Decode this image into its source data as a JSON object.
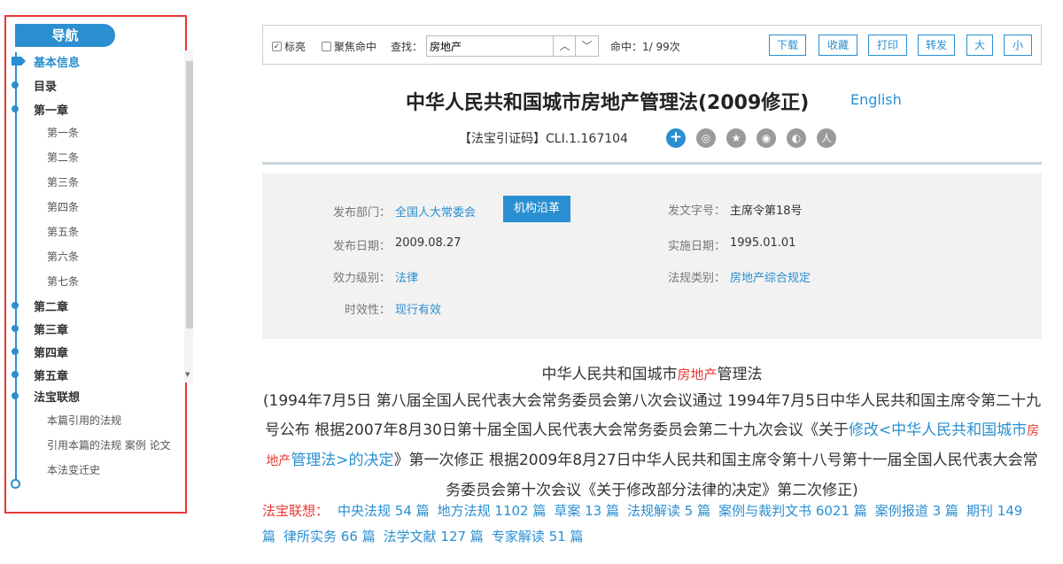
{
  "nav": {
    "title": "导航",
    "items": [
      {
        "label": "基本信息",
        "level": 1,
        "active": true
      },
      {
        "label": "目录",
        "level": 1
      },
      {
        "label": "第一章",
        "level": 1
      },
      {
        "label": "第一条",
        "level": 2
      },
      {
        "label": "第二条",
        "level": 2
      },
      {
        "label": "第三条",
        "level": 2
      },
      {
        "label": "第四条",
        "level": 2
      },
      {
        "label": "第五条",
        "level": 2
      },
      {
        "label": "第六条",
        "level": 2
      },
      {
        "label": "第七条",
        "level": 2
      },
      {
        "label": "第二章",
        "level": 1
      },
      {
        "label": "第三章",
        "level": 1
      },
      {
        "label": "第四章",
        "level": 1
      },
      {
        "label": "第五章",
        "level": 1
      },
      {
        "label": "法宝联想",
        "level": 1
      },
      {
        "label": "本篇引用的法规",
        "level": 2
      },
      {
        "label": "引用本篇的法规 案例 论文",
        "level": 2
      },
      {
        "label": "本法变迁史",
        "level": 2
      }
    ]
  },
  "toolbar": {
    "highlight_label": "标亮",
    "highlight_checked": true,
    "focus_label": "聚焦命中",
    "focus_checked": false,
    "search_label": "查找：",
    "search_value": "房地产",
    "hits": "命中：1/ 99次",
    "buttons": [
      "下载",
      "收藏",
      "打印",
      "转发",
      "大",
      "小"
    ]
  },
  "document": {
    "title": "中华人民共和国城市房地产管理法(2009修正)",
    "english_link": "English",
    "cite_label": "【法宝引证码】",
    "cite_code": "CLI.1.167104",
    "share_icons": [
      "plus-icon",
      "wechat-icon",
      "star-icon",
      "weibo-icon",
      "qq-icon",
      "renren-icon"
    ]
  },
  "meta": {
    "dept_label": "发布部门：",
    "dept_value": "全国人大常委会",
    "org_button": "机构沿革",
    "docno_label": "发文字号：",
    "docno_value": "主席令第18号",
    "pubdate_label": "发布日期：",
    "pubdate_value": "2009.08.27",
    "effdate_label": "实施日期：",
    "effdate_value": "1995.01.01",
    "level_label": "效力级别：",
    "level_value": "法律",
    "category_label": "法规类别：",
    "category_value": "房地产综合规定",
    "validity_label": "时效性：",
    "validity_value": "现行有效"
  },
  "body": {
    "title_pre": "中华人民共和国城市",
    "title_hl": "房地产",
    "title_post": "管理法",
    "preamble_1": "(1994年7月5日 第八届全国人民代表大会常务委员会第八次会议通过 1994年7月5日中华人民共和国主席令第二十九号公布 根据2007年8月30日第十届全国人民代表大会常务委员会第二十九次会议《关于",
    "preamble_link_1": "修改<中华人民共和国城市",
    "preamble_link_hl": "房地产",
    "preamble_link_2": "管理法>的决定",
    "preamble_2": "》第一次修正 根据2009年8月27日中华人民共和国主席令第十八号第十一届全国人民代表大会常务委员会第十次会议《关于修改部分法律的决定》第二次修正)"
  },
  "associations": {
    "label": "法宝联想：",
    "items": [
      "中央法规 54 篇",
      "地方法规 1102 篇",
      "草案 13 篇",
      "法规解读 5 篇",
      "案例与裁判文书 6021 篇",
      "案例报道 3 篇",
      "期刊 149 篇",
      "律所实务 66 篇",
      "法学文献 127 篇",
      "专家解读 51 篇"
    ]
  }
}
